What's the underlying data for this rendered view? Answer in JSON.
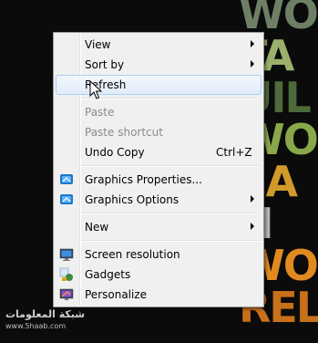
{
  "wallpaper": {
    "lines": [
      "WO",
      "TA",
      "UIL",
      "WO",
      "EA",
      "H",
      "WO",
      "REL"
    ]
  },
  "menu": {
    "view": "View",
    "sort_by": "Sort by",
    "refresh": "Refresh",
    "paste": "Paste",
    "paste_shortcut": "Paste shortcut",
    "undo_copy": "Undo Copy",
    "undo_copy_shortcut": "Ctrl+Z",
    "graphics_properties": "Graphics Properties...",
    "graphics_options": "Graphics Options",
    "new": "New",
    "screen_resolution": "Screen resolution",
    "gadgets": "Gadgets",
    "personalize": "Personalize"
  },
  "watermark": {
    "title": "شبكة المعلومات",
    "url": "www.5haab.com"
  }
}
